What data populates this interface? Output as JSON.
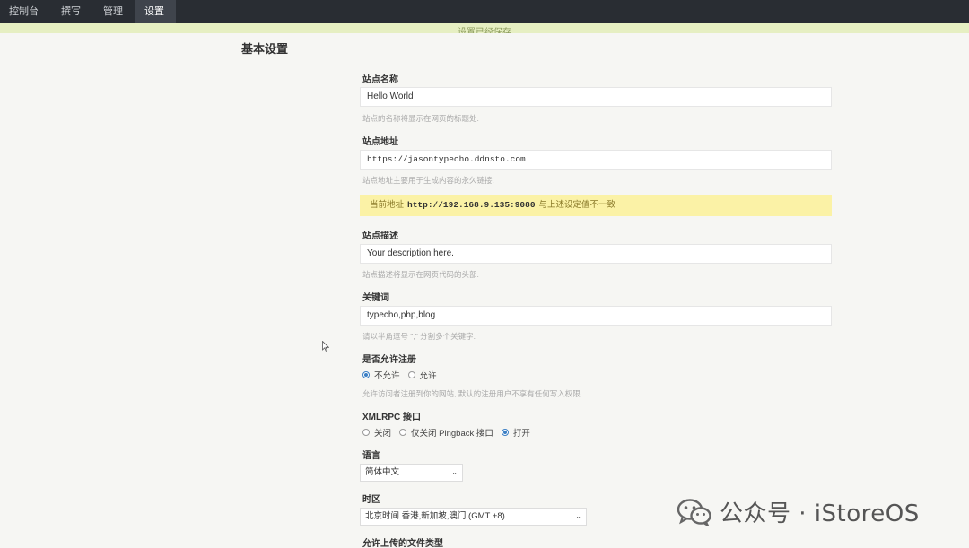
{
  "nav": {
    "items": [
      {
        "label": "控制台"
      },
      {
        "label": "撰写"
      },
      {
        "label": "管理"
      },
      {
        "label": "设置"
      }
    ],
    "active_index": 3
  },
  "notice": {
    "text": "设置已经保存"
  },
  "page": {
    "title": "基本设置"
  },
  "form": {
    "site_name": {
      "label": "站点名称",
      "value": "Hello World",
      "desc": "站点的名称将显示在网页的标题处."
    },
    "site_url": {
      "label": "站点地址",
      "value": "https://jasontypecho.ddnsto.com",
      "desc": "站点地址主要用于生成内容的永久链接."
    },
    "warning": {
      "prefix": "当前地址",
      "url": "http://192.168.9.135:9080",
      "suffix": "与上述设定值不一致"
    },
    "site_desc": {
      "label": "站点描述",
      "value": "Your description here.",
      "desc": "站点描述将显示在网页代码的头部."
    },
    "keywords": {
      "label": "关键词",
      "value": "typecho,php,blog",
      "desc": "请以半角逗号 \",\" 分割多个关键字."
    },
    "allow_register": {
      "label": "是否允许注册",
      "options": [
        "不允许",
        "允许"
      ],
      "selected": 0,
      "desc": "允许访问者注册到你的网站, 默认的注册用户不享有任何写入权限."
    },
    "xmlrpc": {
      "label": "XMLRPC 接口",
      "options": [
        "关闭",
        "仅关闭 Pingback 接口",
        "打开"
      ],
      "selected": 2
    },
    "language": {
      "label": "语言",
      "value": "简体中文"
    },
    "timezone": {
      "label": "时区",
      "value": "北京时间 香港,新加坡,澳门 (GMT +8)"
    },
    "upload_types": {
      "label": "允许上传的文件类型"
    }
  },
  "watermark": {
    "text": "公众号 · iStoreOS"
  },
  "colors": {
    "topbar": "#292d33",
    "notice": "#e6efc2",
    "warning": "#fbf2a6",
    "radio_checked": "#3b7fc4"
  }
}
